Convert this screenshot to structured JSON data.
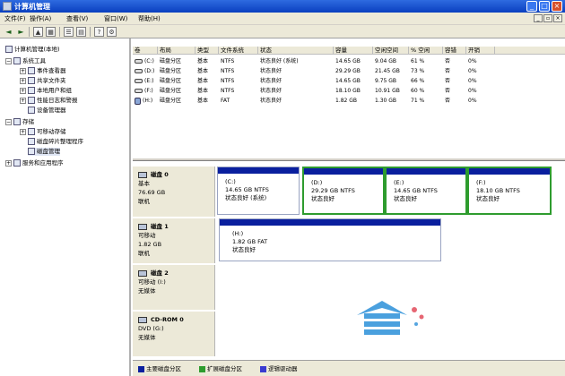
{
  "window": {
    "title": "计算机管理"
  },
  "menu": [
    "文件(F)",
    "操作(A)",
    "查看(V)",
    "窗口(W)",
    "帮助(H)"
  ],
  "tree": [
    {
      "label": "计算机管理(本地)",
      "exp": "",
      "icon": "computer-icon"
    },
    {
      "label": "系统工具",
      "exp": "−",
      "icon": "tools-icon"
    },
    {
      "label": "事件查看器",
      "exp": "+",
      "icon": "event-viewer-icon"
    },
    {
      "label": "共享文件夹",
      "exp": "+",
      "icon": "shared-folder-icon"
    },
    {
      "label": "本地用户和组",
      "exp": "+",
      "icon": "users-icon"
    },
    {
      "label": "性能日志和警报",
      "exp": "+",
      "icon": "performance-icon"
    },
    {
      "label": "设备管理器",
      "exp": "",
      "icon": "device-manager-icon"
    },
    {
      "label": "存储",
      "exp": "−",
      "icon": "storage-icon"
    },
    {
      "label": "可移动存储",
      "exp": "+",
      "icon": "removable-storage-icon"
    },
    {
      "label": "磁盘碎片整理程序",
      "exp": "",
      "icon": "defrag-icon"
    },
    {
      "label": "磁盘管理",
      "exp": "",
      "icon": "disk-management-icon"
    },
    {
      "label": "服务和应用程序",
      "exp": "+",
      "icon": "services-icon"
    }
  ],
  "volume_table": {
    "headers": [
      "卷",
      "布局",
      "类型",
      "文件系统",
      "状态",
      "容量",
      "空闲空间",
      "% 空闲",
      "容错",
      "开销"
    ],
    "rows": [
      [
        "(C:)",
        "磁盘分区",
        "基本",
        "NTFS",
        "状态良好 (系统)",
        "14.65 GB",
        "9.04 GB",
        "61 %",
        "否",
        "0%"
      ],
      [
        "(D:)",
        "磁盘分区",
        "基本",
        "NTFS",
        "状态良好",
        "29.29 GB",
        "21.45 GB",
        "73 %",
        "否",
        "0%"
      ],
      [
        "(E:)",
        "磁盘分区",
        "基本",
        "NTFS",
        "状态良好",
        "14.65 GB",
        "9.75 GB",
        "66 %",
        "否",
        "0%"
      ],
      [
        "(F:)",
        "磁盘分区",
        "基本",
        "NTFS",
        "状态良好",
        "18.10 GB",
        "10.91 GB",
        "60 %",
        "否",
        "0%"
      ],
      [
        "(H:)",
        "磁盘分区",
        "基本",
        "FAT",
        "状态良好",
        "1.82 GB",
        "1.30 GB",
        "71 %",
        "否",
        "0%"
      ]
    ]
  },
  "disks": [
    {
      "name": "磁盘 0",
      "lines": [
        "基本",
        "76.69 GB",
        "联机"
      ],
      "partitions": [
        {
          "drive": "(C:)",
          "size": "14.65 GB NTFS",
          "status": "状态良好 (系统)",
          "kind": "prim"
        },
        {
          "drive": "(D:)",
          "size": "29.29 GB NTFS",
          "status": "状态良好",
          "kind": "ext"
        },
        {
          "drive": "(E:)",
          "size": "14.65 GB NTFS",
          "status": "状态良好",
          "kind": "ext"
        },
        {
          "drive": "(F:)",
          "size": "18.10 GB NTFS",
          "status": "状态良好",
          "kind": "ext"
        }
      ]
    },
    {
      "name": "磁盘 1",
      "lines": [
        "可移动",
        "1.82 GB",
        "联机"
      ],
      "partitions": [
        {
          "drive": "(H:)",
          "size": "1.82 GB FAT",
          "status": "状态良好",
          "kind": "prim"
        }
      ]
    },
    {
      "name": "磁盘 2",
      "lines": [
        "可移动 (I:)",
        "",
        "无媒体"
      ],
      "partitions": []
    },
    {
      "name": "CD-ROM 0",
      "lines": [
        "DVD (G:)",
        "",
        "无媒体"
      ],
      "partitions": []
    }
  ],
  "legend": [
    {
      "label": "主要磁盘分区",
      "color": "#0a1f9e"
    },
    {
      "label": "扩展磁盘分区",
      "color": "#2e9c2e"
    },
    {
      "label": "逻辑驱动器",
      "color": "#3a3ad0"
    }
  ],
  "colors": {
    "title_bar": "#0a3fbf",
    "primary": "#0a1f9e",
    "extended": "#2e9c2e"
  }
}
